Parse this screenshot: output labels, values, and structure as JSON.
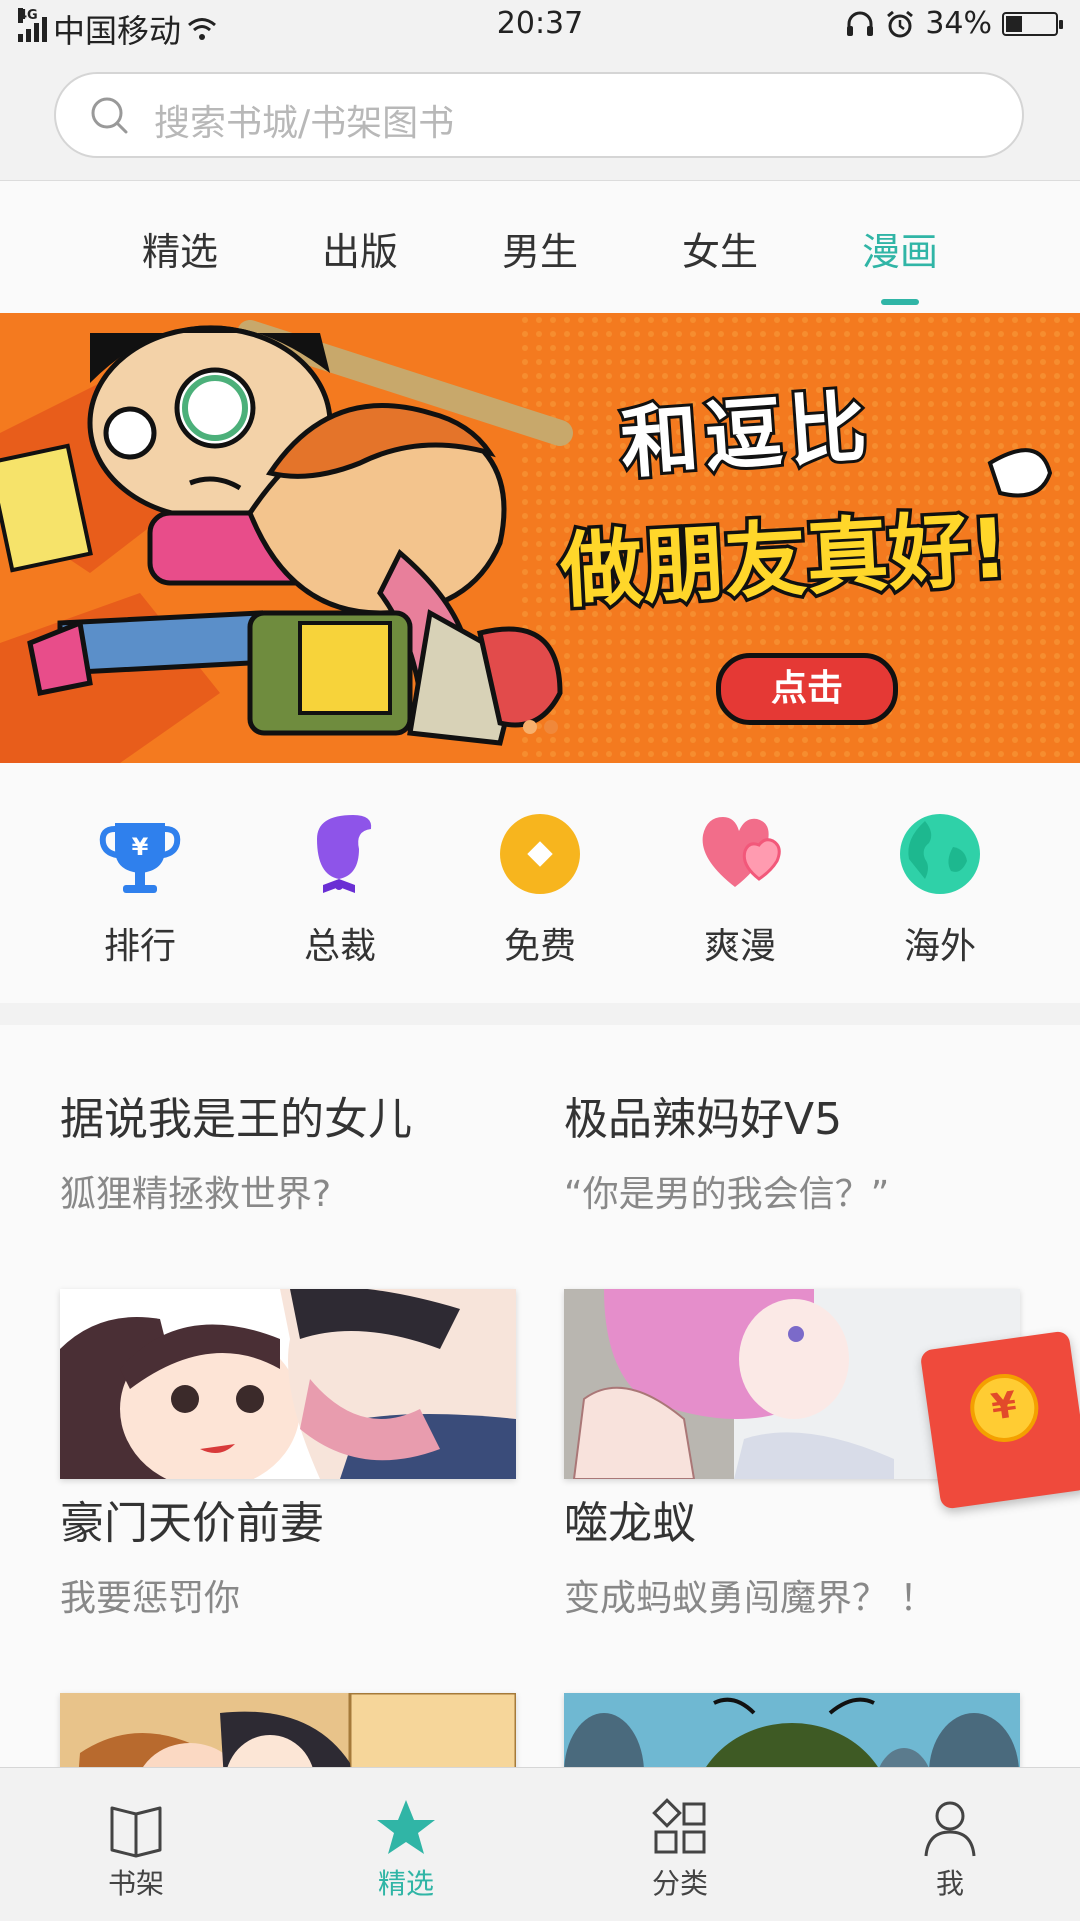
{
  "status_bar": {
    "network_type": "4G",
    "carrier": "中国移动",
    "time": "20:37",
    "battery": "34%",
    "battery_level": 0.34,
    "icons": [
      "signal-icon",
      "wifi-icon",
      "headset-icon",
      "alarm-icon",
      "battery-icon"
    ]
  },
  "search": {
    "placeholder": "搜索书城/书架图书"
  },
  "tabs": [
    {
      "label": "精选",
      "active": false
    },
    {
      "label": "出版",
      "active": false
    },
    {
      "label": "男生",
      "active": false
    },
    {
      "label": "女生",
      "active": false
    },
    {
      "label": "漫画",
      "active": true
    }
  ],
  "banner": {
    "line1_prefix": "和",
    "line1_highlight": "逗比",
    "line2": "做朋友真好!",
    "cta": "点击",
    "page_count": 2,
    "current_page": 1
  },
  "categories": [
    {
      "label": "排行",
      "icon": "trophy-icon",
      "color": "#2f80ed"
    },
    {
      "label": "总裁",
      "icon": "ceo-icon",
      "color": "#8e54e9"
    },
    {
      "label": "免费",
      "icon": "free-coin-icon",
      "color": "#f7b51e"
    },
    {
      "label": "爽漫",
      "icon": "hearts-icon",
      "color": "#f2587a"
    },
    {
      "label": "海外",
      "icon": "globe-icon",
      "color": "#2fd1a8"
    }
  ],
  "comics": [
    {
      "title": "据说我是王的女儿",
      "subtitle": "狐狸精拯救世界?"
    },
    {
      "title": "极品辣妈好V5",
      "subtitle": "“你是男的我会信？”"
    },
    {
      "title": "豪门天价前妻",
      "subtitle": "我要惩罚你"
    },
    {
      "title": "噬龙蚁",
      "subtitle": "变成蚂蚁勇闯魔界？ ！"
    }
  ],
  "red_packet": {
    "symbol": "¥"
  },
  "bottom_nav": [
    {
      "label": "书架",
      "icon": "bookshelf-icon",
      "active": false
    },
    {
      "label": "精选",
      "icon": "star-icon",
      "active": true
    },
    {
      "label": "分类",
      "icon": "category-icon",
      "active": false
    },
    {
      "label": "我",
      "icon": "profile-icon",
      "active": false
    }
  ],
  "colors": {
    "accent": "#30b5a6",
    "banner_bg": "#f47a1f"
  }
}
